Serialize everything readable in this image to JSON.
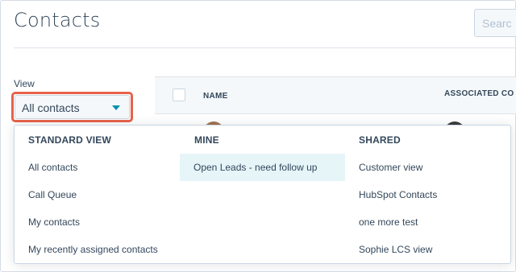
{
  "page": {
    "title": "Contacts"
  },
  "search": {
    "placeholder": "Searc"
  },
  "view": {
    "label": "View",
    "selected": "All contacts"
  },
  "table": {
    "columns": [
      "NAME",
      "ASSOCIATED CO"
    ]
  },
  "dropdown": {
    "standard": {
      "heading": "STANDARD VIEW",
      "items": [
        "All contacts",
        "Call Queue",
        "My contacts",
        "My recently assigned contacts"
      ]
    },
    "mine": {
      "heading": "MINE",
      "items": [
        "Open Leads - need follow up"
      ],
      "selected_index": 0
    },
    "shared": {
      "heading": "SHARED",
      "items": [
        "Customer view",
        "HubSpot Contacts",
        "one more test",
        "Sophie LCS view"
      ]
    }
  },
  "colors": {
    "accent": "#0091ae",
    "highlight_border": "#e8624a",
    "text": "#33475b",
    "selected_bg": "#e5f5f8"
  },
  "icons": {
    "select_caret": "caret-down-icon"
  }
}
